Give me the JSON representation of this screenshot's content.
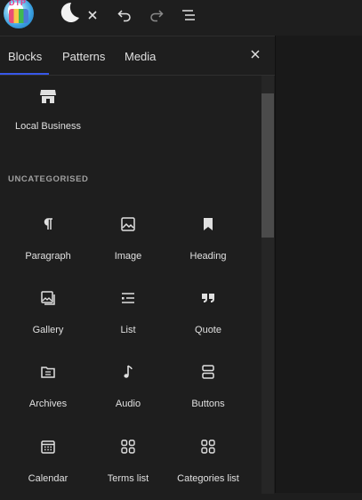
{
  "toolbar": {
    "logo_text": "DTP",
    "icons": [
      "moon-icon",
      "close-icon",
      "undo-icon",
      "redo-icon",
      "document-overview-icon"
    ]
  },
  "tabs": [
    {
      "label": "Blocks",
      "active": true
    },
    {
      "label": "Patterns",
      "active": false
    },
    {
      "label": "Media",
      "active": false
    }
  ],
  "featured_block": {
    "label": "Local Business",
    "icon": "store-icon"
  },
  "section": {
    "title": "UNCATEGORISED"
  },
  "blocks": [
    {
      "label": "Paragraph",
      "icon": "paragraph-icon"
    },
    {
      "label": "Image",
      "icon": "image-icon"
    },
    {
      "label": "Heading",
      "icon": "bookmark-icon"
    },
    {
      "label": "Gallery",
      "icon": "gallery-icon"
    },
    {
      "label": "List",
      "icon": "list-icon"
    },
    {
      "label": "Quote",
      "icon": "quote-icon"
    },
    {
      "label": "Archives",
      "icon": "archive-icon"
    },
    {
      "label": "Audio",
      "icon": "audio-icon"
    },
    {
      "label": "Buttons",
      "icon": "buttons-icon"
    },
    {
      "label": "Calendar",
      "icon": "calendar-icon"
    },
    {
      "label": "Terms list",
      "icon": "grid-icon"
    },
    {
      "label": "Categories list",
      "icon": "grid-icon"
    }
  ],
  "colors": {
    "background": "#1e1e1e",
    "accent": "#3858e9",
    "text": "#e0e0e0"
  }
}
